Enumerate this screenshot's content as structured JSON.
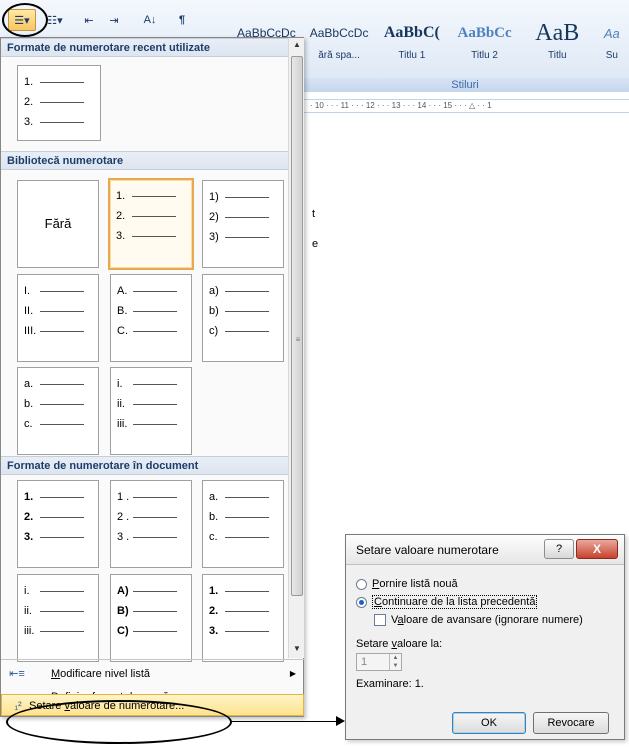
{
  "ribbon": {
    "styles_gallery_label": "Stiluri",
    "styles": [
      {
        "preview": "AaBbCcDc",
        "label": "ără spa..."
      },
      {
        "preview": "AaBbC(",
        "label": "Titlu 1"
      },
      {
        "preview": "AaBbCc",
        "label": "Titlu 2"
      },
      {
        "preview": "AaB",
        "label": "Titlu"
      },
      {
        "preview": "Aa",
        "label": "Su"
      }
    ],
    "partial_style_preview": "AaBbCcDc",
    "ruler_text": "· 10 · · · 11 · · · 12 · · · 13 · · · 14 · · · 15 · · · △ · · 1",
    "toolbar_icons": [
      "numbering-icon",
      "multilevel-list-icon",
      "decrease-indent-icon",
      "increase-indent-icon",
      "sort-icon",
      "show-formatting-icon"
    ]
  },
  "menu": {
    "recent_header": "Formate de numerotare recent utilizate",
    "library_header": "Bibliotecă numerotare",
    "document_header": "Formate de numerotare în document",
    "none_label": "Fără",
    "recent_tile": [
      "1.",
      "2.",
      "3."
    ],
    "library_tiles": [
      [
        "1.",
        "2.",
        "3."
      ],
      [
        "1)",
        "2)",
        "3)"
      ],
      [
        "I.",
        "II.",
        "III."
      ],
      [
        "A.",
        "B.",
        "C."
      ],
      [
        "a)",
        "b)",
        "c)"
      ],
      [
        "a.",
        "b.",
        "c."
      ],
      [
        "i.",
        "ii.",
        "iii."
      ]
    ],
    "document_tiles": [
      [
        "1.",
        "2.",
        "3."
      ],
      [
        "1 .",
        "2 .",
        "3 ."
      ],
      [
        "a.",
        "b.",
        "c."
      ],
      [
        "i.",
        "ii.",
        "iii."
      ],
      [
        "A)",
        "B)",
        "C)"
      ],
      [
        "1.",
        "2.",
        "3."
      ]
    ],
    "change_level_pre": "",
    "change_level_u": "M",
    "change_level_post": "odificare nivel listă",
    "define_format_pre": "",
    "define_format_u": "D",
    "define_format_post": "efinire format de număr nou...",
    "set_value_pre": "Setare ",
    "set_value_u": "v",
    "set_value_post": "aloare de numerotare..."
  },
  "dialog": {
    "title": "Setare valoare numerotare",
    "help": "?",
    "close": "X",
    "new_list_pre": "",
    "new_list_u": "P",
    "new_list_post": "ornire listă nouă",
    "continue_pre": "",
    "continue_u": "C",
    "continue_post": "ontinuare de la lista precedentă",
    "advance_pre": "V",
    "advance_u": "a",
    "advance_post": "loare de avansare (ignorare numere)",
    "set_value_label_pre": "Setare ",
    "set_value_label_u": "v",
    "set_value_label_post": "aloare la:",
    "value": "1",
    "preview": "Examinare: 1.",
    "ok": "OK",
    "cancel": "Revocare"
  }
}
